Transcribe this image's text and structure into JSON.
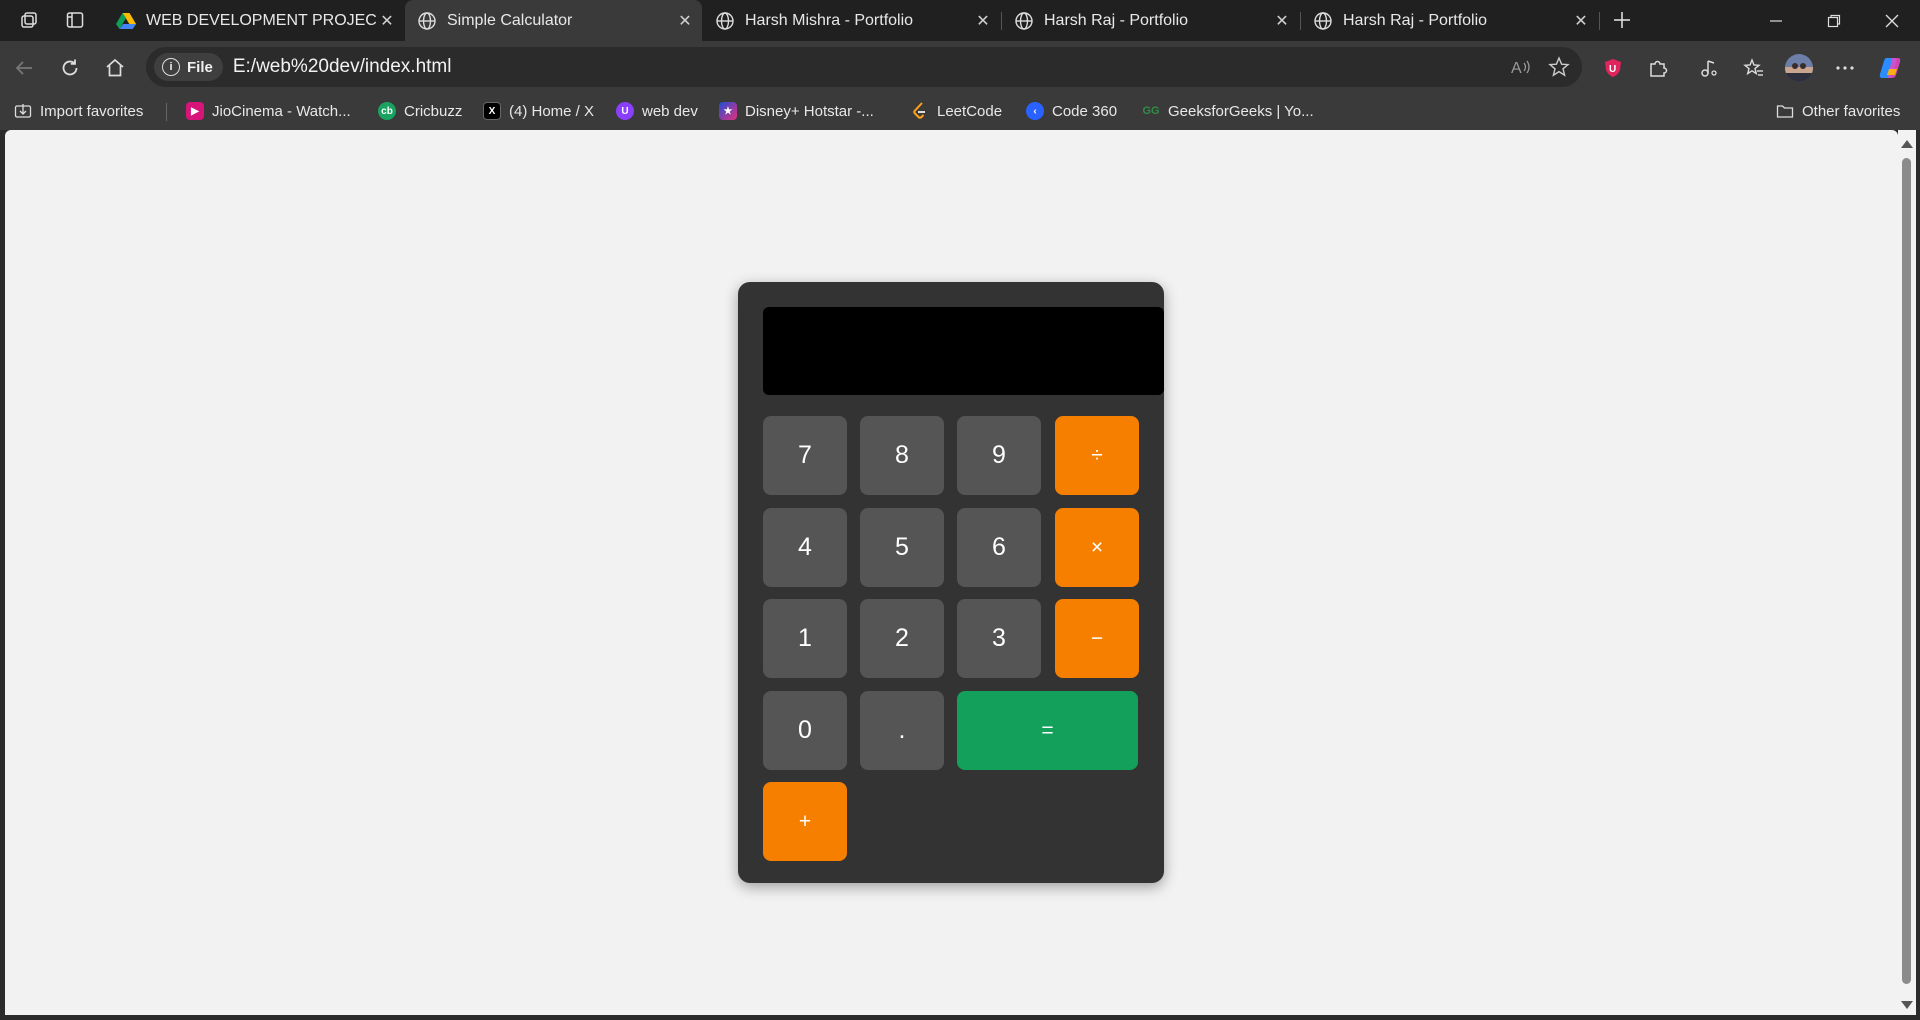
{
  "tabs": [
    {
      "title": "WEB DEVELOPMENT PROJECTS.pd",
      "icon": "google-drive-icon",
      "active": false
    },
    {
      "title": "Simple Calculator",
      "icon": "globe-icon",
      "active": true
    },
    {
      "title": "Harsh Mishra - Portfolio",
      "icon": "globe-icon",
      "active": false
    },
    {
      "title": "Harsh Raj - Portfolio",
      "icon": "globe-icon",
      "active": false
    },
    {
      "title": "Harsh Raj - Portfolio",
      "icon": "globe-icon",
      "active": false
    }
  ],
  "address": {
    "scheme_label": "File",
    "url": "E:/web%20dev/index.html"
  },
  "favorites": [
    {
      "label": "Import favorites",
      "icon": "import-icon"
    },
    {
      "label": "JioCinema - Watch...",
      "icon": "jiocinema-icon",
      "color": "#d6147a"
    },
    {
      "label": "Cricbuzz",
      "icon": "cricbuzz-icon",
      "color": "#1aa260"
    },
    {
      "label": "(4) Home / X",
      "icon": "x-icon",
      "color": "#000000"
    },
    {
      "label": "web dev",
      "icon": "web-dev-icon",
      "color": "#8a3ffc"
    },
    {
      "label": "Disney+ Hotstar -...",
      "icon": "hotstar-icon",
      "color": "#1f4fd8"
    },
    {
      "label": "LeetCode",
      "icon": "leetcode-icon",
      "color": "#ffa116"
    },
    {
      "label": "Code 360",
      "icon": "code360-icon",
      "color": "#2962ff"
    },
    {
      "label": "GeeksforGeeks | Yo...",
      "icon": "gfg-icon",
      "color": "#2f8d46"
    },
    {
      "label": "Other favorites",
      "icon": "folder-icon"
    }
  ],
  "calculator": {
    "display_value": "",
    "keys": [
      "7",
      "8",
      "9",
      "÷",
      "4",
      "5",
      "6",
      "×",
      "1",
      "2",
      "3",
      "−",
      "0",
      ".",
      "=",
      "+"
    ],
    "colors": {
      "number": "#555555",
      "operator": "#f77f00",
      "equals": "#13a05a",
      "body": "#333333",
      "display": "#000000"
    }
  }
}
